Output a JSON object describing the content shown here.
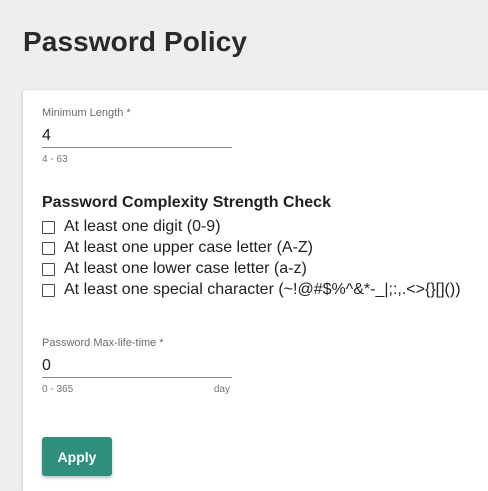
{
  "page": {
    "title": "Password Policy"
  },
  "min_length": {
    "label": "Minimum Length *",
    "value": "4",
    "hint": "4 - 63"
  },
  "complexity": {
    "heading": "Password Complexity Strength Check",
    "options": [
      {
        "label": "At least one digit (0-9)",
        "checked": false
      },
      {
        "label": "At least one upper case letter (A-Z)",
        "checked": false
      },
      {
        "label": "At least one lower case letter (a-z)",
        "checked": false
      },
      {
        "label": "At least one special character (~!@#$%^&*-_|;:,.<>{}[]())",
        "checked": false
      }
    ]
  },
  "max_life": {
    "label": "Password Max-life-time *",
    "value": "0",
    "hint": "0 - 365",
    "unit": "day"
  },
  "actions": {
    "apply_label": "Apply"
  },
  "colors": {
    "accent": "#2f8f7e",
    "background": "#eeeeee"
  }
}
